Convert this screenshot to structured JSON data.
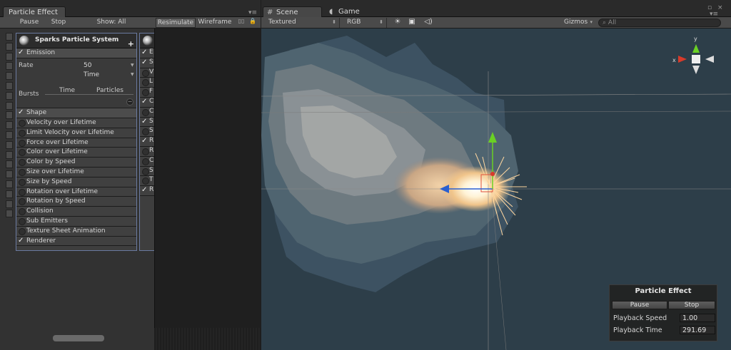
{
  "left_window": {
    "tab_title": "Particle Effect",
    "toolbar": {
      "pause": "Pause",
      "stop": "Stop",
      "show": "Show: All",
      "resimulate": "Resimulate",
      "wireframe": "Wireframe"
    },
    "particle_system": {
      "title": "Sparks Particle System",
      "emission": {
        "label": "Emission",
        "rate_label": "Rate",
        "rate_value": "50",
        "rate_mode": "Time",
        "bursts_label": "Bursts",
        "bursts_columns": [
          "Time",
          "Particles"
        ]
      },
      "modules": [
        {
          "label": "Shape",
          "enabled": true
        },
        {
          "label": "Velocity over Lifetime",
          "enabled": false
        },
        {
          "label": "Limit Velocity over Lifetime",
          "enabled": false
        },
        {
          "label": "Force over Lifetime",
          "enabled": false
        },
        {
          "label": "Color over Lifetime",
          "enabled": false
        },
        {
          "label": "Color by Speed",
          "enabled": false
        },
        {
          "label": "Size over Lifetime",
          "enabled": false
        },
        {
          "label": "Size by Speed",
          "enabled": false
        },
        {
          "label": "Rotation over Lifetime",
          "enabled": false
        },
        {
          "label": "Rotation by Speed",
          "enabled": false
        },
        {
          "label": "Collision",
          "enabled": false
        },
        {
          "label": "Sub Emitters",
          "enabled": false
        },
        {
          "label": "Texture Sheet Animation",
          "enabled": false
        },
        {
          "label": "Renderer",
          "enabled": true
        }
      ]
    },
    "second_system_rows": [
      {
        "letter": "E",
        "checked": true
      },
      {
        "letter": "S",
        "checked": true
      },
      {
        "letter": "V",
        "checked": false
      },
      {
        "letter": "L",
        "checked": false
      },
      {
        "letter": "F",
        "checked": false
      },
      {
        "letter": "C",
        "checked": true
      },
      {
        "letter": "C",
        "checked": false
      },
      {
        "letter": "S",
        "checked": true
      },
      {
        "letter": "S",
        "checked": false
      },
      {
        "letter": "R",
        "checked": true
      },
      {
        "letter": "R",
        "checked": false
      },
      {
        "letter": "C",
        "checked": false
      },
      {
        "letter": "S",
        "checked": false
      },
      {
        "letter": "T",
        "checked": false
      },
      {
        "letter": "R",
        "checked": true
      }
    ]
  },
  "scene_window": {
    "tabs": {
      "scene": "Scene",
      "game": "Game"
    },
    "toolbar": {
      "render_mode": "Textured",
      "color_mode": "RGB",
      "gizmos": "Gizmos",
      "search_placeholder": "All"
    },
    "axis_labels": {
      "x": "x",
      "y": "y"
    },
    "overlay": {
      "title": "Particle Effect",
      "pause": "Pause",
      "stop": "Stop",
      "playback_speed_label": "Playback Speed",
      "playback_speed": "1.00",
      "playback_time_label": "Playback Time",
      "playback_time": "291.69"
    }
  },
  "colors": {
    "selection_outline": "#6a7aa0",
    "viewport_bg": "#2d3e49",
    "axis_x": "#d83a2a",
    "axis_y": "#6ad024",
    "axis_z": "#2a5fd0"
  }
}
